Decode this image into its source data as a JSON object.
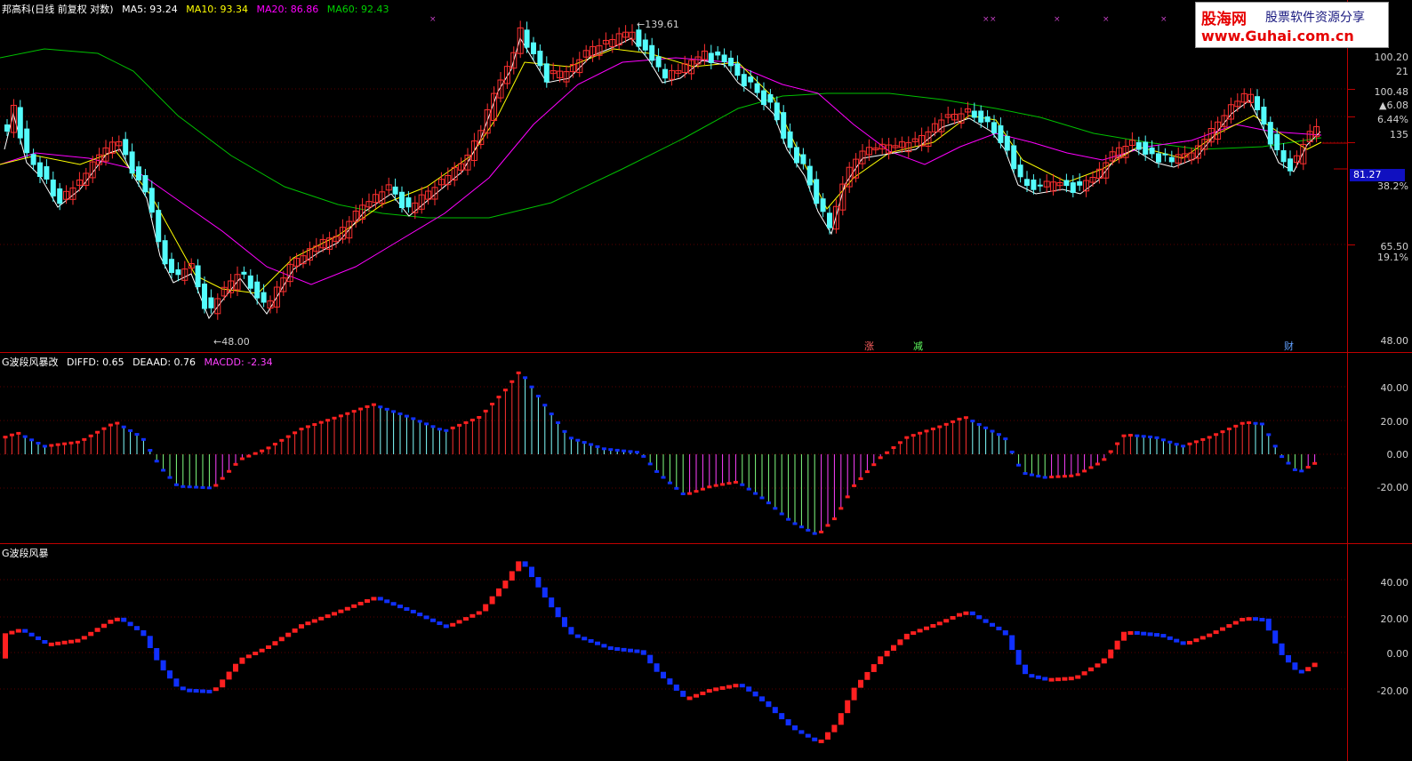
{
  "header": {
    "title": "邦高科(日线 前复权 对数)",
    "ma5_label": "MA5: 93.24",
    "ma10_label": "MA10: 93.34",
    "ma20_label": "MA20: 86.86",
    "ma60_label": "MA60: 92.43"
  },
  "logo": {
    "brand": "股海网",
    "slogan": "股票软件资源分享",
    "url": "www.Guhai.com.cn"
  },
  "main": {
    "high_label": "139.61",
    "low_label": "48.00",
    "current_price": "81.27",
    "axis_ticks": [
      "100.20",
      "21",
      "100.48",
      "▲6.08",
      "6.44%",
      "135",
      "38.2%",
      "65.50",
      "19.1%",
      "48.00"
    ],
    "event_markers": [
      "涨",
      "减",
      "财"
    ]
  },
  "macd_panel": {
    "title": "G波段风暴改",
    "diffd": "DIFFD: 0.65",
    "deaad": "DEAAD: 0.76",
    "macdd": "MACDD: -2.34",
    "axis_ticks": [
      "40.00",
      "20.00",
      "0.00",
      "-20.00"
    ]
  },
  "wave_panel": {
    "title": "G波段风暴",
    "axis_ticks": [
      "40.00",
      "20.00",
      "0.00",
      "-20.00"
    ]
  },
  "colors": {
    "up": "#ff3030",
    "down": "#54fcfc",
    "ma5": "#ffffff",
    "ma10": "#ffff00",
    "ma20": "#ff00ff",
    "ma60": "#00c000",
    "wave_up": "#ff2020",
    "wave_down": "#1030ff",
    "grid": "#c00000"
  },
  "chart_data": {
    "type": "line",
    "title": "",
    "xlabel": "",
    "ylabel": "",
    "y_log": true,
    "ylim": [
      48.0,
      139.61
    ],
    "series": [
      {
        "name": "MA5",
        "values": [
          93.24
        ]
      },
      {
        "name": "MA10",
        "values": [
          93.34
        ]
      },
      {
        "name": "MA20",
        "values": [
          86.86
        ]
      },
      {
        "name": "MA60",
        "values": [
          92.43
        ]
      }
    ],
    "indicator": {
      "DIFFD": 0.65,
      "DEAAD": 0.76,
      "MACDD": -2.34,
      "ylim": [
        -25,
        50
      ]
    }
  }
}
